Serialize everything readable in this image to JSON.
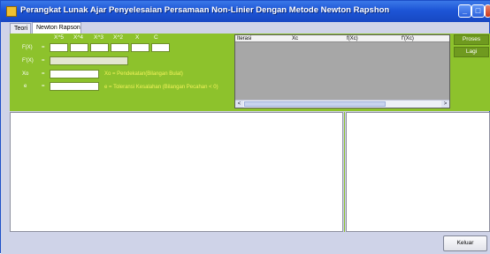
{
  "window": {
    "title": "Perangkat Lunak Ajar Penyelesaian Persamaan Non-Linier Dengan Metode Newton Rapshon",
    "controls": {
      "minimize": "_",
      "maximize": "□",
      "close": "✕"
    }
  },
  "tabs": [
    {
      "label": "Teori"
    },
    {
      "label": "Newton Rapson"
    }
  ],
  "form": {
    "coef_headers": [
      "X^5",
      "X^4",
      "X^3",
      "X^2",
      "X",
      "C"
    ],
    "fx_label": "F(X)",
    "fpx_label": "F'(X)",
    "xo_label": "Xo",
    "e_label": "e",
    "equals": "=",
    "xo_hint": "Xo = Pendekatan(Bilangan Bulat)",
    "e_hint": "e = Toleransi Kesalahan (Bilangan Pecahan < 0)"
  },
  "grid": {
    "columns": [
      "Iterasi",
      "Xc",
      "f(Xc)",
      "f'(Xc)"
    ],
    "scroll_left": "<",
    "scroll_right": ">"
  },
  "buttons": {
    "proses": "Proses",
    "lagi": "Lagi",
    "keluar": "Keluar"
  }
}
